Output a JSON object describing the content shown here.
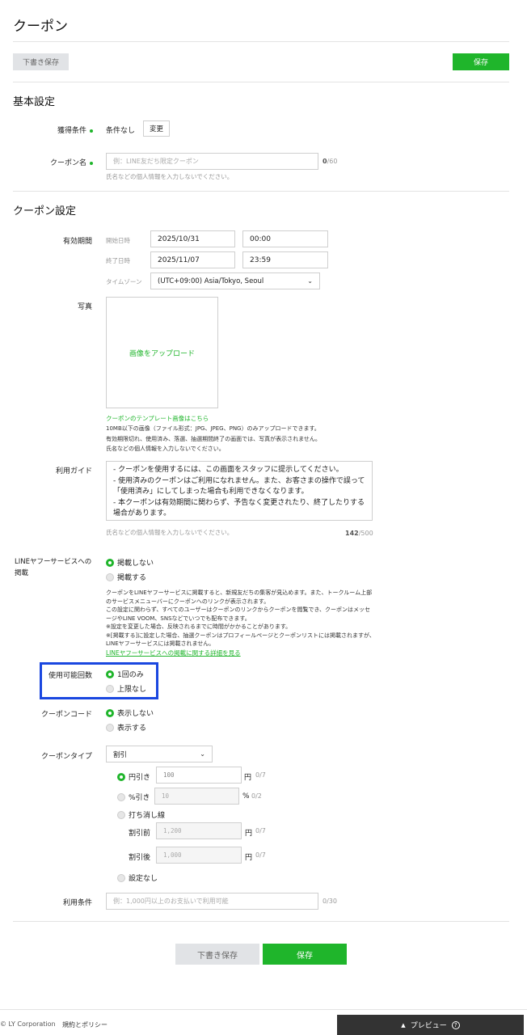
{
  "page": {
    "title": "クーポン",
    "draft_save_label": "下書き保存",
    "save_label": "保存"
  },
  "basic": {
    "section_title": "基本設定",
    "acquire_label": "獲得条件",
    "acquire_value": "条件なし",
    "change_label": "変更",
    "name_label": "クーポン名",
    "name_placeholder": "例：LINE友だち限定クーポン",
    "name_count": "0",
    "name_max": "/60",
    "name_hint": "氏名などの個人情報を入力しないでください。"
  },
  "coupon": {
    "section_title": "クーポン設定",
    "period_label": "有効期間",
    "start_label": "開始日時",
    "start_date": "2025/10/31",
    "start_time": "00:00",
    "end_label": "終了日時",
    "end_date": "2025/11/07",
    "end_time": "23:59",
    "timezone_label": "タイムゾーン",
    "timezone_value": "(UTC+09:00) Asia/Tokyo, Seoul",
    "photo_label": "写真",
    "upload_label": "画像をアップロード",
    "template_link": "クーポンのテンプレート画像はこちら",
    "photo_note1": "10MB以下の画像（ファイル形式：JPG、JPEG、PNG）のみアップロードできます。",
    "photo_note2": "有効期限切れ、使用済み、落選、抽選期間終了の画面では、写真が表示されません。",
    "photo_note3": "氏名などの個人情報を入力しないでください。",
    "guide_label": "利用ガイド",
    "guide_text": "- クーポンを使用するには、この画面をスタッフに提示してください。\n- 使用済みのクーポンはご利用になれません。また、お客さまの操作で誤って「使用済み」にしてしまった場合も利用できなくなります。\n- 本クーポンは有効期間に関わらず、予告なく変更されたり、終了したりする場合があります。",
    "guide_hint": "氏名などの個人情報を入力しないでください。",
    "guide_count": "142",
    "guide_max": "/500",
    "yahoo_label_1": "LINEヤフーサービスへの",
    "yahoo_label_2": "掲載",
    "yahoo_opt1": "掲載しない",
    "yahoo_opt2": "掲載する",
    "yahoo_note1": "クーポンをLINEヤフーサービスに掲載すると、新規友だちの集客が見込めます。また、トークルーム上部",
    "yahoo_note2": "のサービスメニューバーにクーポンへのリンクが表示されます。",
    "yahoo_note3": "この設定に関わらず、すべてのユーザーはクーポンのリンクからクーポンを閲覧でき、クーポンはメッセ",
    "yahoo_note4": "ージやLINE VOOM、SNSなどでいつでも配布できます。",
    "yahoo_note5": "※設定を変更した場合、反映されるまでに時間がかかることがあります。",
    "yahoo_note6": "※[掲載する]に設定した場合、抽選クーポンはプロフィールページとクーポンリストには掲載されますが、",
    "yahoo_note7": "LINEヤフーサービスには掲載されません。",
    "yahoo_link": "LINEヤフーサービスへの掲載に関する詳細を見る",
    "usage_label": "使用可能回数",
    "usage_opt1": "1回のみ",
    "usage_opt2": "上限なし",
    "code_label": "クーポンコード",
    "code_opt1": "表示しない",
    "code_opt2": "表示する",
    "type_label": "クーポンタイプ",
    "type_value": "割引",
    "yen_label": "円引き",
    "yen_value": "100",
    "yen_unit": "円",
    "yen_count": "0/7",
    "pct_label": "%引き",
    "pct_value": "10",
    "pct_unit": "%",
    "pct_count": "0/2",
    "strike_label": "打ち消し線",
    "before_label": "割引前",
    "before_value": "1,200",
    "before_unit": "円",
    "before_count": "0/7",
    "after_label": "割引後",
    "after_value": "1,000",
    "after_unit": "円",
    "after_count": "0/7",
    "none_label": "設定なし",
    "terms_label": "利用条件",
    "terms_placeholder": "例：1,000円以上のお支払いで利用可能",
    "terms_count": "0/30"
  },
  "bottom": {
    "draft_save_label": "下書き保存",
    "save_label": "保存"
  },
  "footer": {
    "copyright": "© LY Corporation",
    "policy": "規約とポリシー",
    "preview": "プレビュー"
  },
  "colors": {
    "accent": "#1fb52b",
    "highlight": "#1a47e0"
  }
}
